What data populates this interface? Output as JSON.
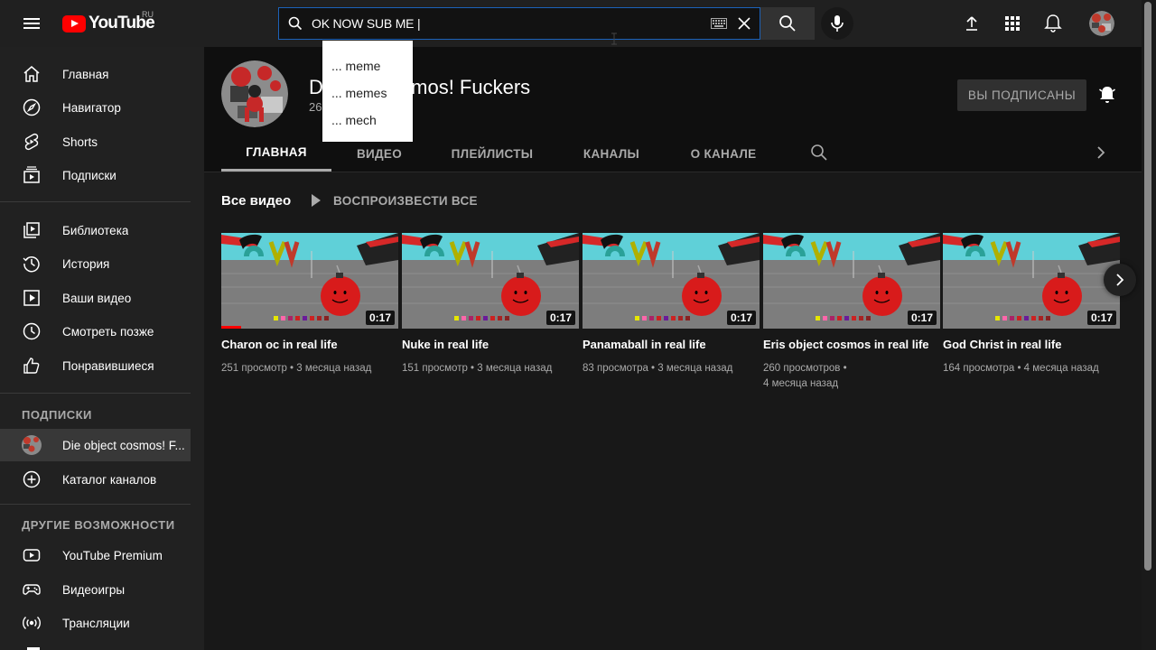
{
  "header": {
    "logo_text": "YouTube",
    "logo_region": "RU",
    "search_value": "OK NOW SUB ME |",
    "icons": [
      "menu-icon",
      "search-icon",
      "keyboard-icon",
      "clear-icon",
      "mic-icon",
      "upload-icon",
      "apps-icon",
      "bell-icon"
    ]
  },
  "search_suggestions": [
    "... meme",
    "... memes",
    "... mech"
  ],
  "sidebar": {
    "main": [
      {
        "label": "Главная",
        "icon": "home-icon"
      },
      {
        "label": "Навигатор",
        "icon": "explore-icon"
      },
      {
        "label": "Shorts",
        "icon": "shorts-icon"
      },
      {
        "label": "Подписки",
        "icon": "subscriptions-icon"
      }
    ],
    "library": [
      {
        "label": "Библиотека",
        "icon": "library-icon"
      },
      {
        "label": "История",
        "icon": "history-icon"
      },
      {
        "label": "Ваши видео",
        "icon": "your-videos-icon"
      },
      {
        "label": "Смотреть позже",
        "icon": "watch-later-icon"
      },
      {
        "label": "Понравившиеся",
        "icon": "like-icon"
      }
    ],
    "subscriptions_heading": "ПОДПИСКИ",
    "subscriptions": [
      {
        "label": "Die object cosmos! F...",
        "icon": "channel-avatar"
      },
      {
        "label": "Каталог каналов",
        "icon": "add-circle-icon"
      }
    ],
    "more_heading": "ДРУГИЕ ВОЗМОЖНОСТИ",
    "more": [
      {
        "label": "YouTube Premium",
        "icon": "youtube-premium-icon"
      },
      {
        "label": "Видеоигры",
        "icon": "gaming-icon"
      },
      {
        "label": "Трансляции",
        "icon": "live-icon"
      }
    ]
  },
  "channel": {
    "name_visible": "D",
    "name_rest": "osmos! Fuckers",
    "subs_visible": "26",
    "subscribe_label": "ВЫ ПОДПИСАНЫ",
    "tabs": [
      "ГЛАВНАЯ",
      "ВИДЕО",
      "ПЛЕЙЛИСТЫ",
      "КАНАЛЫ",
      "О КАНАЛЕ"
    ]
  },
  "section": {
    "title": "Все видео",
    "play_all": "ВОСПРОИЗВЕСТИ ВСЕ"
  },
  "videos": [
    {
      "title": "Charon oc in real life",
      "meta": "251 просмотр • 3 месяца назад",
      "duration": "0:17"
    },
    {
      "title": "Nuke in real life",
      "meta": "151 просмотр • 3 месяца назад",
      "duration": "0:17"
    },
    {
      "title": "Panamaball in real life",
      "meta": "83 просмотра • 3 месяца назад",
      "duration": "0:17"
    },
    {
      "title": "Eris object cosmos in real life",
      "meta": "260 просмотров •",
      "meta2": "4 месяца назад",
      "duration": "0:17"
    },
    {
      "title": "God Christ in real life",
      "meta": "164 просмотра • 4 месяца назад",
      "duration": "0:17"
    }
  ],
  "colors": {
    "brand_red": "#ff0000",
    "search_border": "#1c62b9",
    "background": "#181818",
    "sidebar": "#212121"
  }
}
